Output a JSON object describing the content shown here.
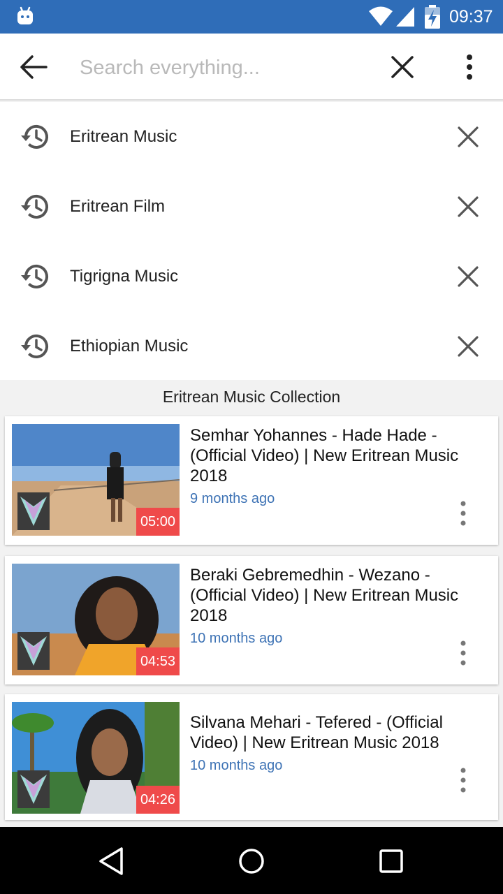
{
  "status_bar": {
    "time": "09:37",
    "icons": [
      "android-notification-icon",
      "wifi-icon",
      "signal-icon",
      "battery-charging-icon"
    ]
  },
  "toolbar": {
    "search_placeholder": "Search everything...",
    "search_value": "",
    "icons": [
      "arrow-back-icon",
      "close-icon",
      "more-vert-icon"
    ]
  },
  "history": {
    "items": [
      {
        "label": "Eritrean Music"
      },
      {
        "label": "Eritrean Film"
      },
      {
        "label": "Tigrigna Music"
      },
      {
        "label": "Ethiopian Music"
      }
    ],
    "item_icon": "history-icon",
    "remove_icon": "close-icon"
  },
  "section_title": "Eritrean Music Collection",
  "videos": [
    {
      "title": "Semhar Yohannes - Hade Hade - (Official Video) | New Eritrean Music 2018",
      "time_ago": "9 months ago",
      "duration": "05:00"
    },
    {
      "title": "Beraki Gebremedhin - Wezano - (Official Video) | New Eritrean Music 2018",
      "time_ago": "10 months ago",
      "duration": "04:53"
    },
    {
      "title": "Silvana Mehari - Tefered - (Official Video) | New Eritrean Music 2018",
      "time_ago": "10 months ago",
      "duration": "04:26"
    }
  ],
  "nav_bar": {
    "icons": [
      "nav-back-icon",
      "nav-home-icon",
      "nav-recents-icon"
    ]
  },
  "colors": {
    "status_bar": "#2f6db8",
    "duration_badge": "#ef4a4a",
    "time_ago_text": "#3e73b5"
  }
}
